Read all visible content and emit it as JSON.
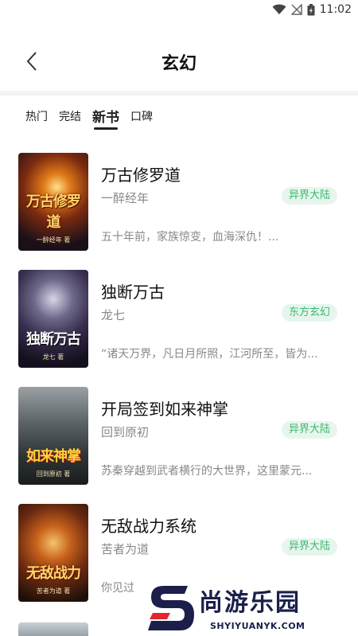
{
  "status_bar": {
    "time": "11:02",
    "icons": [
      "wifi-icon",
      "signal-off-icon",
      "battery-icon"
    ]
  },
  "header": {
    "back_icon": "chevron-left-icon",
    "title": "玄幻"
  },
  "tabs": [
    {
      "label": "热门",
      "active": false
    },
    {
      "label": "完结",
      "active": false
    },
    {
      "label": "新书",
      "active": true
    },
    {
      "label": "口碑",
      "active": false
    }
  ],
  "books": [
    {
      "title": "万古修罗道",
      "author": "一醉经年",
      "tag": "异界大陆",
      "desc": "五十年前，家族惊变，血海深仇！...",
      "cover_title": "万古修罗道",
      "cover_author": "一醉经年 著"
    },
    {
      "title": "独断万古",
      "author": "龙七",
      "tag": "东方玄幻",
      "desc": "“诸天万界，凡日月所照，江河所至，皆为...",
      "cover_title": "独断万古",
      "cover_author": "龙七 著"
    },
    {
      "title": "开局签到如来神掌",
      "author": "回到原初",
      "tag": "异界大陆",
      "desc": "苏秦穿越到武者横行的大世界，这里蒙元...",
      "cover_title": "如来神掌",
      "cover_author": "回到原初 著"
    },
    {
      "title": "无敌战力系统",
      "author": "苦者为道",
      "tag": "异界大陆",
      "desc": "你见过",
      "cover_title": "无敌战力",
      "cover_author": "苦者为道 著"
    }
  ],
  "watermark": {
    "brand": "尚游乐园",
    "url": "SHYIYUANYK.COM"
  },
  "colors": {
    "accent_green": "#3fb871",
    "tag_bg": "#e6f6ed",
    "watermark_blue": "#1b1f4a",
    "watermark_red": "#e3262e"
  }
}
